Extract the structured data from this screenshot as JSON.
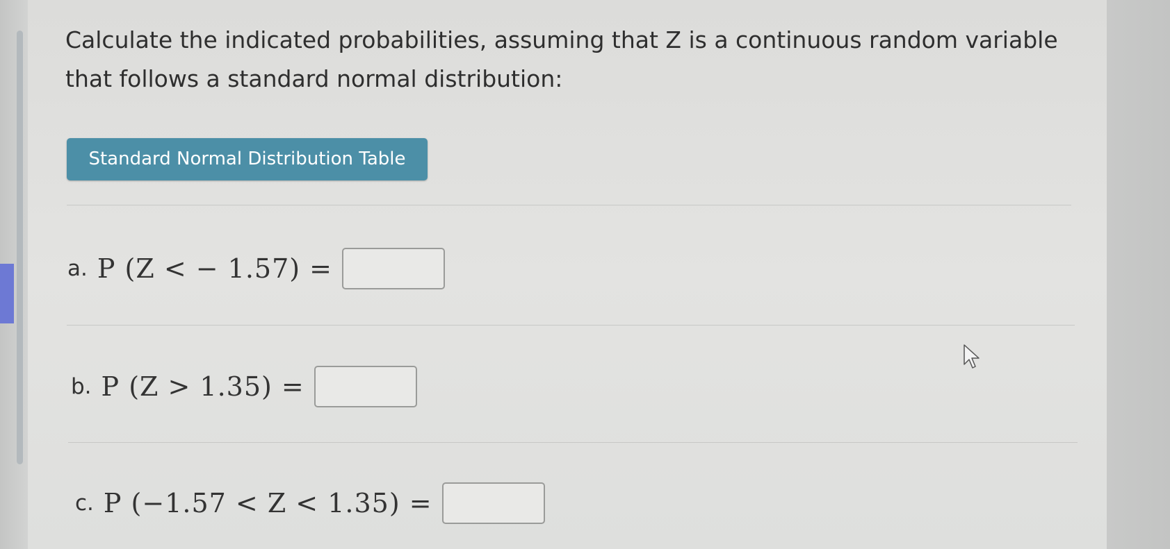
{
  "question": {
    "text": "Calculate the indicated probabilities, assuming that Z is a continuous random variable that follows a standard normal distribution:"
  },
  "table_button": {
    "label": "Standard Normal Distribution Table"
  },
  "parts": [
    {
      "label": "a.",
      "expression": "P (Z < − 1.57) =",
      "answer": ""
    },
    {
      "label": "b.",
      "expression": "P (Z > 1.35) =",
      "answer": ""
    },
    {
      "label": "c.",
      "expression": "P (−1.57 < Z < 1.35) =",
      "answer": ""
    }
  ],
  "icons": {
    "cursor": "mouse-pointer-icon"
  },
  "colors": {
    "button_bg": "#4c8fa7",
    "button_text": "#ffffff",
    "left_highlight": "#6d79d4"
  }
}
